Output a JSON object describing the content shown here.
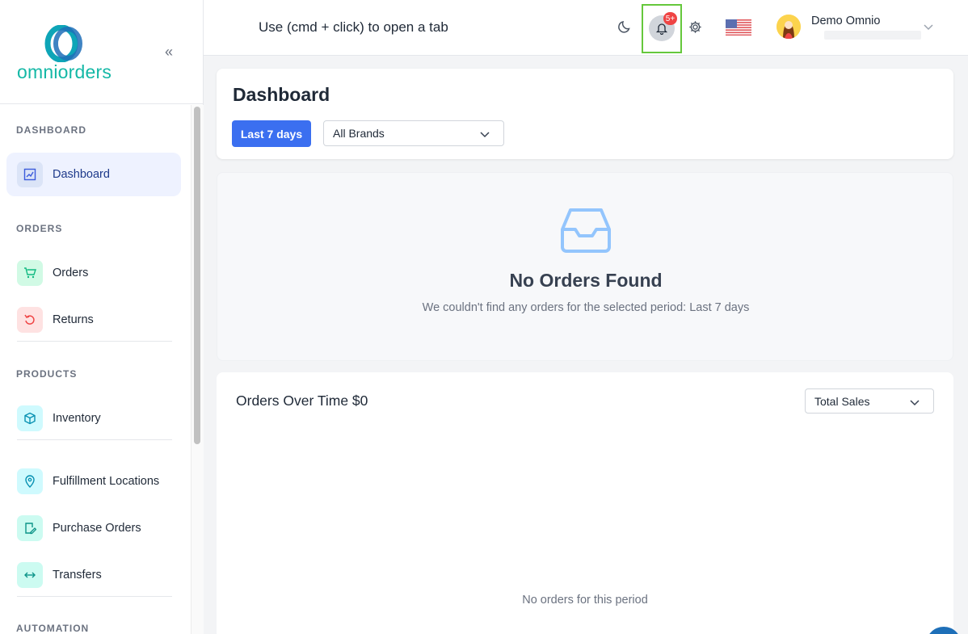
{
  "sidebar": {
    "logo_text": "omniorders",
    "collapse_label": "«",
    "sections": {
      "dashboard": "DASHBOARD",
      "orders": "ORDERS",
      "products": "PRODUCTS",
      "automation": "AUTOMATION"
    },
    "items": {
      "dashboard": "Dashboard",
      "orders": "Orders",
      "returns": "Returns",
      "inventory": "Inventory",
      "fulfillment": "Fulfillment Locations",
      "purchase_orders": "Purchase Orders",
      "transfers": "Transfers"
    }
  },
  "topbar": {
    "hint": "Use (cmd + click) to open a tab",
    "notification_badge": "5+",
    "user_name": "Demo Omnio"
  },
  "dashboard": {
    "title": "Dashboard",
    "period_button": "Last 7 days",
    "brand_select": "All Brands"
  },
  "empty_state": {
    "title": "No Orders Found",
    "message": "We couldn't find any orders for the selected period: Last 7 days"
  },
  "chart": {
    "title": "Orders Over Time $0",
    "metric_select": "Total Sales",
    "empty_message": "No orders for this period"
  },
  "colors": {
    "brand_teal": "#14b8a6",
    "primary_blue": "#3b6ff0",
    "highlight_green": "#65c83c",
    "badge_red": "#ef4444"
  }
}
